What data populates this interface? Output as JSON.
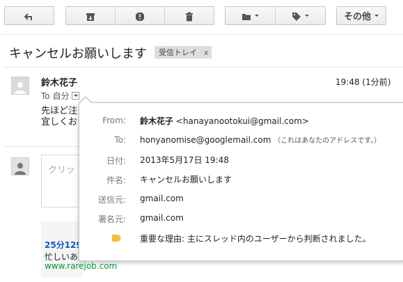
{
  "toolbar": {
    "back_icon": "back-arrow-icon",
    "archive_icon": "archive-icon",
    "spam_icon": "report-spam-icon",
    "delete_icon": "trash-icon",
    "folder_icon": "folder-move-icon",
    "label_icon": "label-tag-icon",
    "more_label": "その他"
  },
  "thread": {
    "subject": "キャンセルお願いします",
    "label_chip": "受信トレイ",
    "label_chip_close": "x"
  },
  "message": {
    "sender_name": "鈴木花子",
    "to_text": "To 自分",
    "time": "19:48 (1分前)",
    "body_line1": "先ほど注",
    "body_line2": "宜しくお"
  },
  "reply": {
    "placeholder": "クリッ"
  },
  "ad": {
    "title": "25分129",
    "desc": "忙しいあ",
    "url": "www.rarejob.com"
  },
  "details": {
    "from_label": "From:",
    "from_name": "鈴木花子",
    "from_email": "<hanayanootokui@gmail.com>",
    "to_label": "To:",
    "to_email": "honyanomise@googlemail.com",
    "to_note": "（これはあなたのアドレスです。）",
    "date_label": "日付:",
    "date_value": "2013年5月17日 19:48",
    "subject_label": "件名:",
    "subject_value": "キャンセルお願いします",
    "mailedby_label": "送信元:",
    "mailedby_value": "gmail.com",
    "signedby_label": "署名元:",
    "signedby_value": "gmail.com",
    "importance_value": "重要な理由: 主にスレッド内のユーザーから判断されました。"
  },
  "colors": {
    "link": "#1155cc",
    "ad_url": "#009933",
    "importance_tag": "#f1c232"
  }
}
